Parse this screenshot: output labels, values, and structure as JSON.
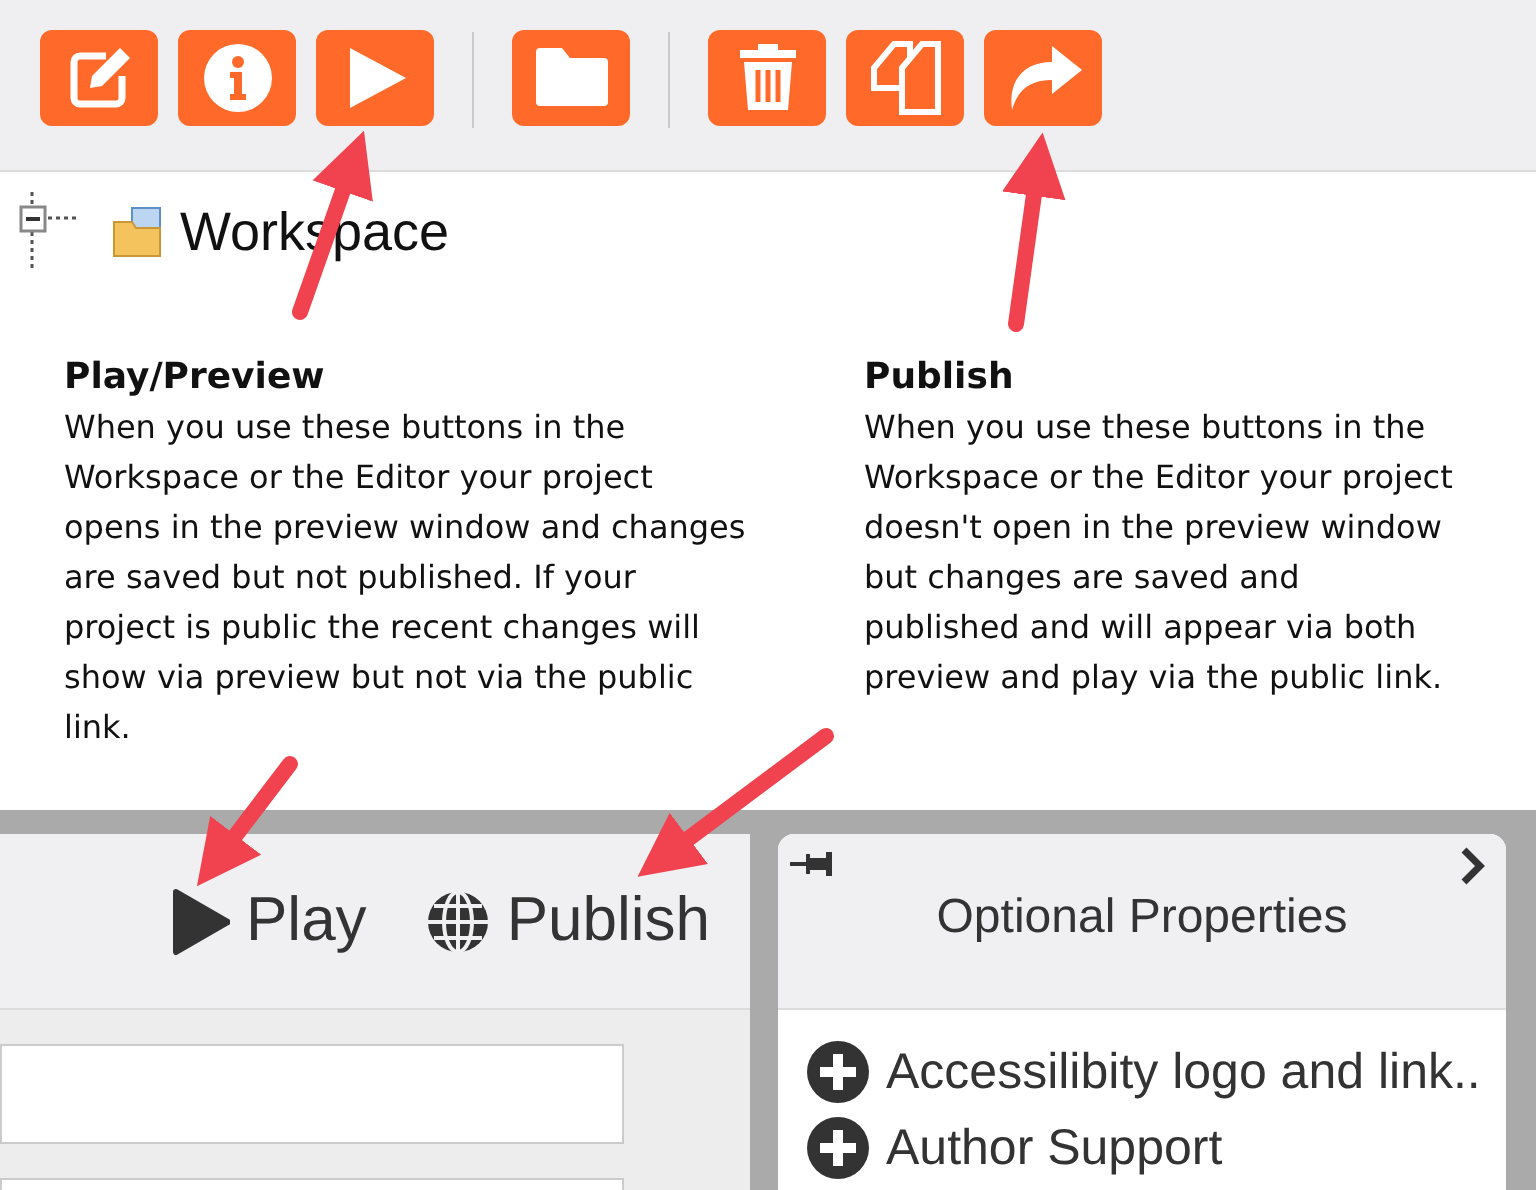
{
  "toolbar": {
    "groups": [
      {
        "buttons": [
          {
            "kind": "edit"
          },
          {
            "kind": "info"
          },
          {
            "kind": "play"
          }
        ]
      },
      {
        "buttons": [
          {
            "kind": "folder"
          }
        ]
      },
      {
        "buttons": [
          {
            "kind": "trash"
          },
          {
            "kind": "copy"
          },
          {
            "kind": "share"
          }
        ]
      }
    ]
  },
  "tree": {
    "label": "Workspace",
    "expanded": true
  },
  "annotations": [
    {
      "title": "Play/Preview",
      "text": "When you use these buttons in the Workspace or the Editor your project opens in the preview window and changes are saved but not published. If your project is public the recent changes will show via preview but not via the public link."
    },
    {
      "title": "Publish",
      "text": "When you use these buttons in the Workspace or the Editor your project doesn't open in the preview window but changes are saved and published and will appear via both preview and play via the public link."
    }
  ],
  "editor": {
    "actions": [
      {
        "kind": "play",
        "label": "Play"
      },
      {
        "kind": "publish",
        "label": "Publish"
      }
    ]
  },
  "properties_panel": {
    "title": "Optional Properties",
    "items": [
      {
        "label": "Accessilibity logo and link.."
      },
      {
        "label": "Author Support"
      }
    ]
  }
}
